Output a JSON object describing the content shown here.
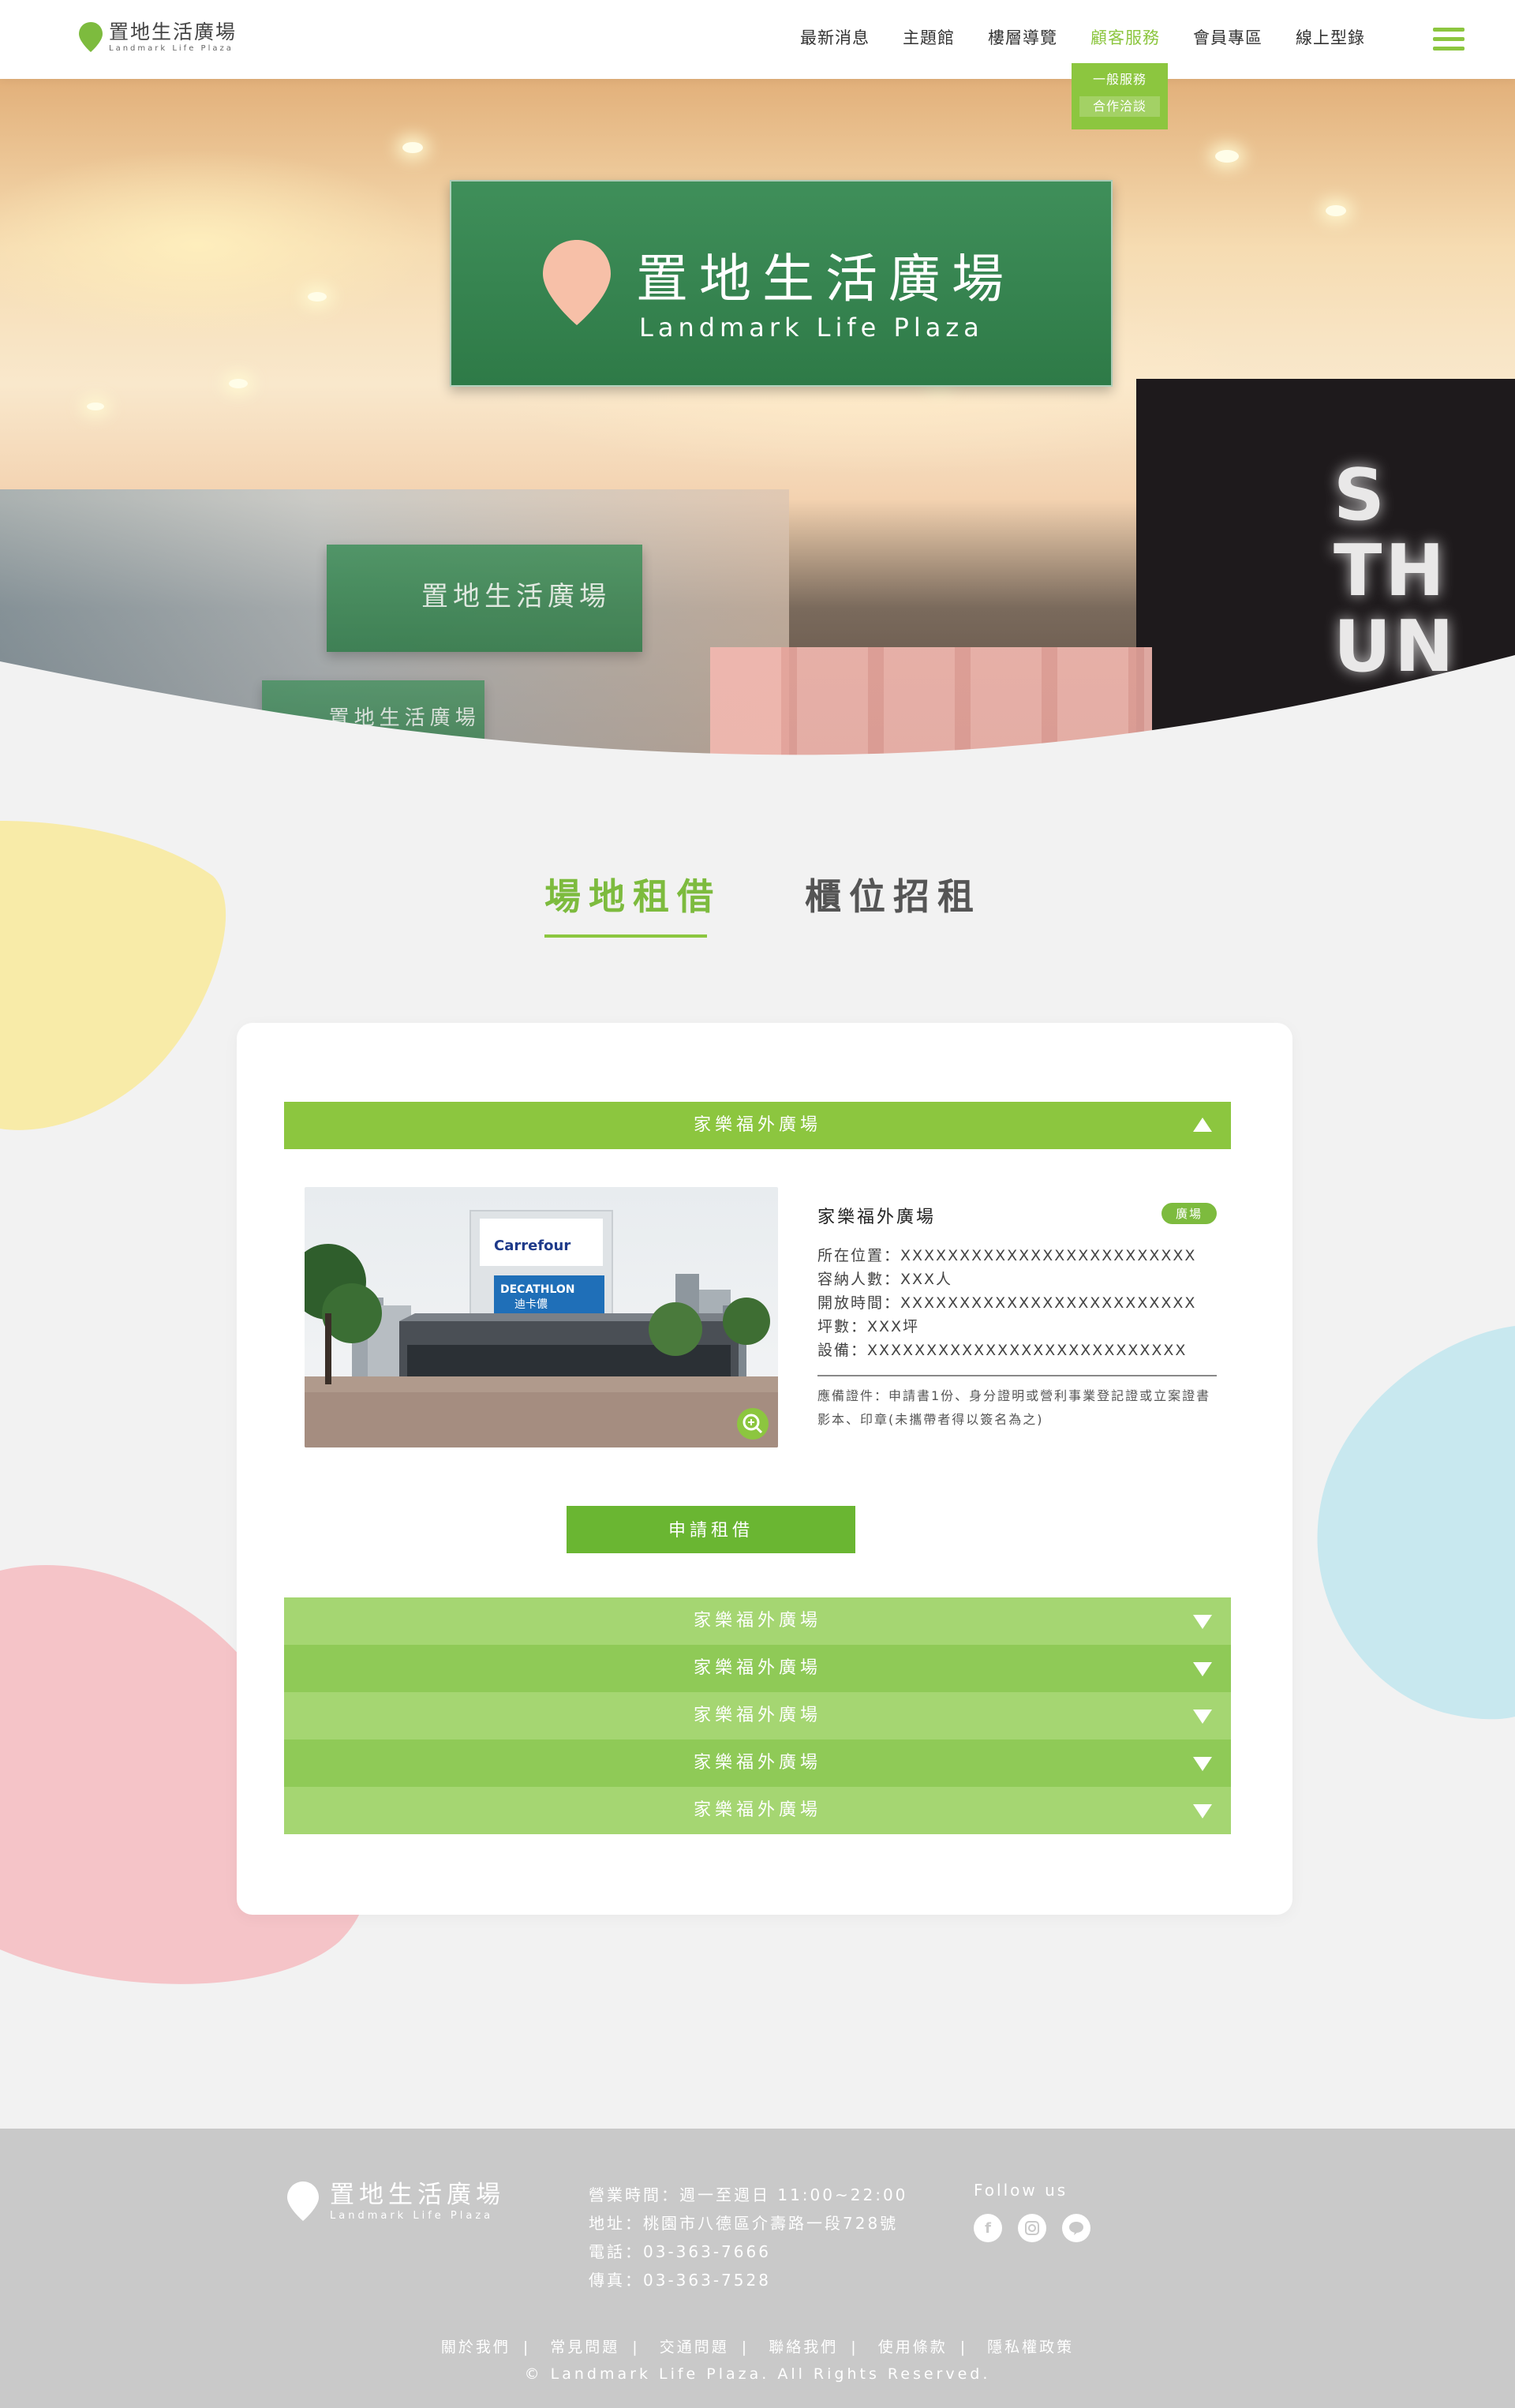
{
  "header": {
    "logo_cn": "置地生活廣場",
    "logo_en": "Landmark Life Plaza",
    "nav": [
      "最新消息",
      "主題館",
      "樓層導覽",
      "顧客服務",
      "會員專區",
      "線上型錄"
    ],
    "active_nav": "顧客服務",
    "submenu": [
      "一般服務",
      "合作洽談"
    ]
  },
  "hero": {
    "sign_cn": "置地生活廣場",
    "sign_en": "Landmark Life Plaza"
  },
  "tabs": [
    "場地租借",
    "櫃位招租"
  ],
  "accordion": {
    "open_item": {
      "header": "家樂福外廣場",
      "title": "家樂福外廣場",
      "badge": "廣場",
      "rows": [
        "所在位置：XXXXXXXXXXXXXXXXXXXXXXXXX",
        "容納人數：XXX人",
        "開放時間：XXXXXXXXXXXXXXXXXXXXXXXXX",
        "坪數：XXX坪",
        "設備：XXXXXXXXXXXXXXXXXXXXXXXXXXX"
      ],
      "note": "應備證件：申請書1份、身分證明或營利事業登記證或立案證書影本、印章(未攜帶者得以簽名為之)",
      "image_labels": {
        "brand": "Carrefour",
        "store": "DECATHLON",
        "store_cn": "迪卡儂"
      },
      "apply_label": "申請租借"
    },
    "collapsed_items": [
      "家樂福外廣場",
      "家樂福外廣場",
      "家樂福外廣場",
      "家樂福外廣場",
      "家樂福外廣場"
    ]
  },
  "footer": {
    "logo_cn": "置地生活廣場",
    "logo_en": "Landmark Life Plaza",
    "info": [
      "營業時間：週一至週日 11:00~22:00",
      "地址：桃園市八德區介壽路一段728號",
      "電話：03-363-7666",
      "傳真：03-363-7528"
    ],
    "follow": "Follow us",
    "socials": [
      "facebook-icon",
      "instagram-icon",
      "line-icon"
    ],
    "links": [
      "關於我們",
      "常見問題",
      "交通問題",
      "聯絡我們",
      "使用條款",
      "隱私權政策"
    ],
    "copyright": "© Landmark Life Plaza. All Rights Reserved."
  },
  "colors": {
    "accent": "#8cc63f",
    "accent_dark": "#6ab632",
    "accent_light": "#a5d672",
    "background": "#f2f2f2",
    "footer": "#c9c9c9",
    "blob_yellow": "#f8eba8",
    "blob_pink": "#f5c4c8",
    "blob_blue": "#c8e8ef",
    "pin_pink": "#f7c0a8"
  }
}
